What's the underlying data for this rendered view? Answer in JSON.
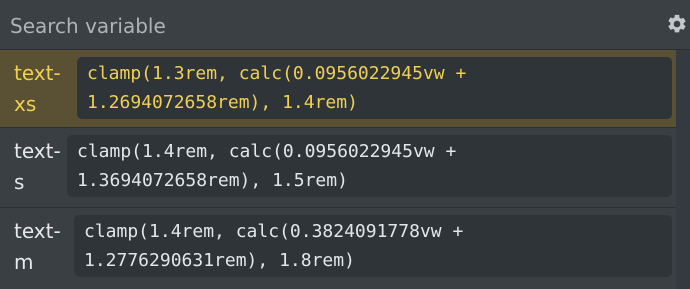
{
  "search": {
    "placeholder": "Search variable"
  },
  "icons": {
    "settings": "gear-icon"
  },
  "variables": [
    {
      "name": "text-xs",
      "value": "clamp(1.3rem, calc(0.0956022945vw +\n1.2694072658rem), 1.4rem)",
      "selected": true
    },
    {
      "name": "text-s",
      "value": "clamp(1.4rem, calc(0.0956022945vw +\n1.3694072658rem), 1.5rem)",
      "selected": false
    },
    {
      "name": "text-m",
      "value": "clamp(1.4rem, calc(0.3824091778vw +\n1.2776290631rem), 1.8rem)",
      "selected": false
    }
  ],
  "colors": {
    "selected_text": "#f0cf55",
    "selected_bg": "#5a5134",
    "panel_bg": "#3a3f44"
  }
}
